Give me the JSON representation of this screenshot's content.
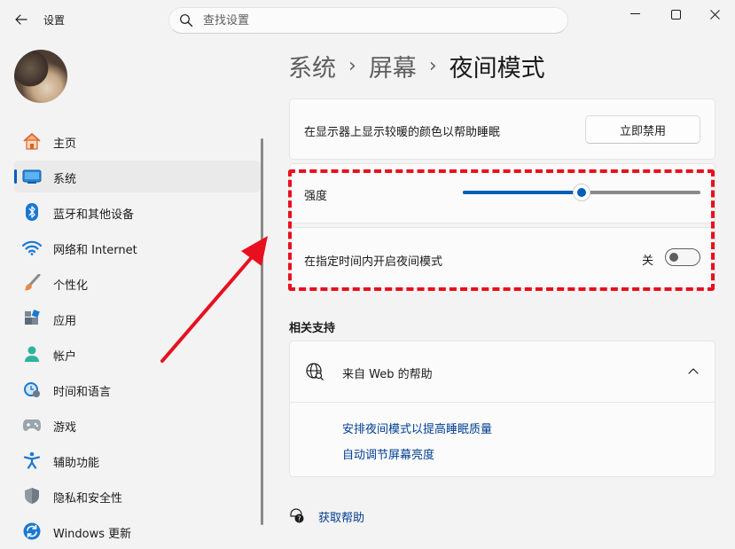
{
  "window": {
    "title": "设置",
    "search_placeholder": "查找设置"
  },
  "sidebar": {
    "items": [
      {
        "label": "主页",
        "icon": "home-icon"
      },
      {
        "label": "系统",
        "icon": "system-icon",
        "active": true
      },
      {
        "label": "蓝牙和其他设备",
        "icon": "bluetooth-icon"
      },
      {
        "label": "网络和 Internet",
        "icon": "wifi-icon"
      },
      {
        "label": "个性化",
        "icon": "brush-icon"
      },
      {
        "label": "应用",
        "icon": "apps-icon"
      },
      {
        "label": "帐户",
        "icon": "account-icon"
      },
      {
        "label": "时间和语言",
        "icon": "clock-globe-icon"
      },
      {
        "label": "游戏",
        "icon": "gamepad-icon"
      },
      {
        "label": "辅助功能",
        "icon": "accessibility-icon"
      },
      {
        "label": "隐私和安全性",
        "icon": "shield-icon"
      },
      {
        "label": "Windows 更新",
        "icon": "update-icon"
      }
    ]
  },
  "breadcrumb": {
    "items": [
      "系统",
      "屏幕",
      "夜间模式"
    ],
    "separator": "›"
  },
  "night_light": {
    "description": "在显示器上显示较暖的颜色以帮助睡眠",
    "disable_button": "立即禁用",
    "strength_label": "强度",
    "strength_value": 0.5,
    "schedule_label": "在指定时间内开启夜间模式",
    "schedule_state": "关",
    "schedule_on": false
  },
  "related": {
    "title": "相关支持",
    "web_help_title": "来自 Web 的帮助",
    "links": [
      "安排夜间模式以提高睡眠质量",
      "自动调节屏幕亮度"
    ]
  },
  "footer": {
    "get_help": "获取帮助"
  },
  "colors": {
    "accent": "#005fb8",
    "annotation": "#e8101f",
    "link": "#003e92"
  }
}
